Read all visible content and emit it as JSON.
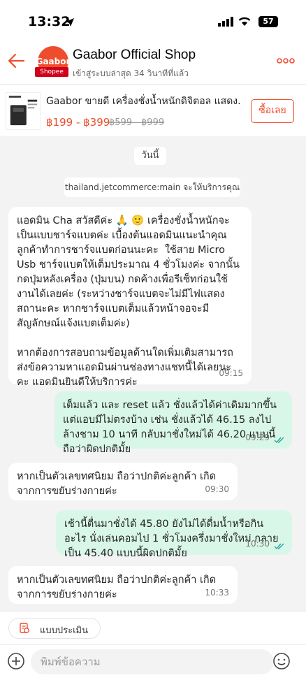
{
  "status_bar": {
    "time": "13:32",
    "battery": "57",
    "icons": [
      "location-arrow-icon",
      "signal-icon",
      "wifi-icon",
      "battery-icon"
    ]
  },
  "header": {
    "shop_name": "Gaabor Official Shop",
    "shop_status": "เข้าสู่ระบบล่าสุด 34 วินาทีที่แล้ว",
    "logo_text": "Gaabor",
    "mall_badge": "Shopee Mall"
  },
  "product": {
    "title": "Gaabor ขายดี เครื่องชั่งน้ำหนักดิจิตอล แสดง...",
    "price": "฿199 - ฿399",
    "original_price": "฿599 - ฿999",
    "buy_label": "ซื้อเลย"
  },
  "chat": {
    "date_label": "วันนี้",
    "notice": "thailand.jetcommerce:main จะให้บริการคุณ",
    "messages": [
      {
        "direction": "in",
        "text": "แอดมิน Cha สวัสดีค่ะ 🙏 🙂 เครื่องชั่งน้ำหนักจะเป็นแบบชาร์จแบตค่ะ เบื้องต้นแอดมินแนะนำคุณลูกค้าทำการชาร์จแบตก่อนนะคะ  ใช้สาย Micro Usb ชาร์จแบตให้เต็มประมาณ 4 ชั่วโมงค่ะ จากนั้นกดปุ่มหลังเครื่อง (ปุ่มบน) กดค้างเพื่อรีเซ็ทก่อนใช้งานได้เลยค่ะ (ระหว่างชาร์จแบตจะไม่มีไฟแสดงสถานะคะ หากชาร์จแบตเต็มแล้วหน้าจอจะมีสัญลักษณ์แจ้งแบตเต็มค่ะ)\n\nหากต้องการสอบถามข้อมูลด้านใดเพิ่มเติมสามารถส่งข้อความหาแอดมินผ่านช่องทางแชทนี้ได้เลยนะคะ แอดมินยินดีให้บริการค่ะ",
        "time": "09:15"
      },
      {
        "direction": "out",
        "text": "เต็มแล้ว และ reset แล้ว ชั่งแล้วได้ค่าเดิมมากขึ้นแต่แอบมีไม่ตรงบ้าง เช่น ชั่งแล้วได้ 46.15 ลงไปล้างชาม 10 นาที กลับมาชั่งใหม่ได้ 46.20 แบบนี้ถือว่าผิดปกติมั้ย",
        "time": "09:29"
      },
      {
        "direction": "in",
        "text": "หากเป็นตัวเลขทศนิยม ถือว่าปกติค่ะลูกค้า เกิดจากการขยับร่างกายค่ะ",
        "time": "09:30"
      },
      {
        "direction": "out",
        "text": "เช้านี้ตื่นมาชั่งได้ 45.80 ยังไม่ได้ดื่มน้ำหรือกินอะไร นั่งเล่นคอมไป 1 ชั่วโมงครึ่งมาชั่งใหม่ กลายเป็น 45.40 แบบนี้ผิดปกติมั้ย",
        "time": "10:30"
      },
      {
        "direction": "in",
        "text": "หากเป็นตัวเลขทศนิยม ถือว่าปกติค่ะลูกค้า เกิดจากการขยับร่างกายค่ะ",
        "time": "10:33"
      }
    ]
  },
  "bottom": {
    "rate_label": "แบบประเมิน",
    "input_placeholder": "พิมพ์ข้อความ"
  },
  "colors": {
    "accent": "#ee4d2d",
    "outgoing_bubble": "#d9f7e9",
    "read_ticks": "#26a69a"
  }
}
